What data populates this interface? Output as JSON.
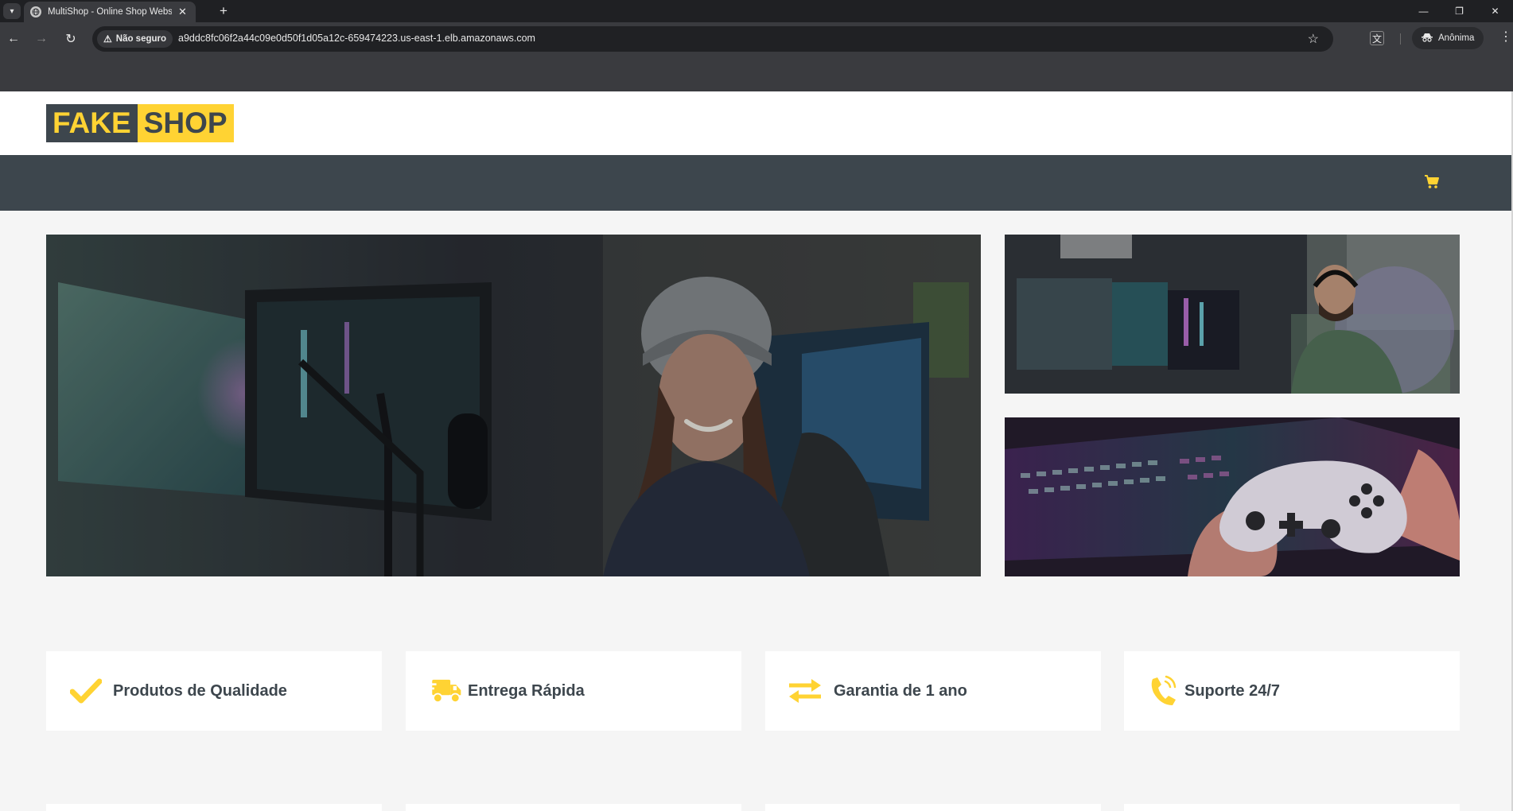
{
  "browser": {
    "tab_title": "MultiShop - Online Shop Website",
    "tab_close": "✕",
    "new_tab": "+",
    "security_label": "Não seguro",
    "url": "a9ddc8fc06f2a44c09e0d50f1d05a12c-659474223.us-east-1.elb.amazonaws.com",
    "incognito_label": "Anônima",
    "win_minimize": "—",
    "win_restore": "❐",
    "win_close": "✕"
  },
  "site": {
    "logo_part1": "FAKE",
    "logo_part2": "SHOP"
  },
  "carousel": {
    "slide_count": 3,
    "active_slide": 1
  },
  "features": [
    {
      "label": "Produtos de Qualidade",
      "icon": "check-icon"
    },
    {
      "label": "Entrega Rápida",
      "icon": "shipping-fast-icon"
    },
    {
      "label": "Garantia de 1 ano",
      "icon": "exchange-arrows-icon"
    },
    {
      "label": "Suporte 24/7",
      "icon": "phone-volume-icon"
    }
  ],
  "colors": {
    "accent": "#ffd333",
    "dark": "#3d464d",
    "background": "#f5f5f5"
  }
}
